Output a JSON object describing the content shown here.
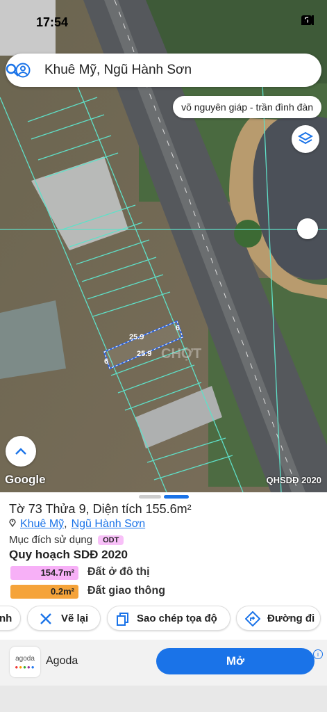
{
  "status_bar": {
    "time": "17:54",
    "network_badge": "5"
  },
  "search": {
    "query": "Khuê Mỹ, Ngũ Hành Sơn"
  },
  "suggestion_chip": "võ nguyên giáp - trần đình đàn",
  "map": {
    "attribution": "Google",
    "layer_label": "QHSDĐ 2020",
    "measurements": {
      "top_length": "25.9",
      "bottom_length": "25.9",
      "right_width": "6",
      "left_width": "6"
    },
    "watermark": "CHỢT"
  },
  "parcel": {
    "title": "Tờ 73 Thửa 9, Diện tích 155.6m²",
    "ward": "Khuê Mỹ",
    "separator": ",",
    "district": "Ngũ Hành Sơn",
    "purpose_label": "Mục đích sử dụng",
    "purpose_code": "ODT",
    "plan_title": "Quy hoạch SDĐ 2020",
    "land_uses": [
      {
        "area": "154.7m²",
        "label": "Đất ở đô thị",
        "color": "#f7b0f7"
      },
      {
        "area": "0.2m²",
        "label": "Đất giao thông",
        "color": "#f5a33a"
      }
    ]
  },
  "actions": {
    "partial": "nh",
    "redraw": "Vẽ lại",
    "copy_coords": "Sao chép tọa độ",
    "directions": "Đường đi"
  },
  "ad": {
    "brand_logo": "agoda",
    "name": "Agoda",
    "cta": "Mở"
  },
  "colors": {
    "accent": "#1a73e8",
    "parcel_line": "#5fe0c8"
  }
}
